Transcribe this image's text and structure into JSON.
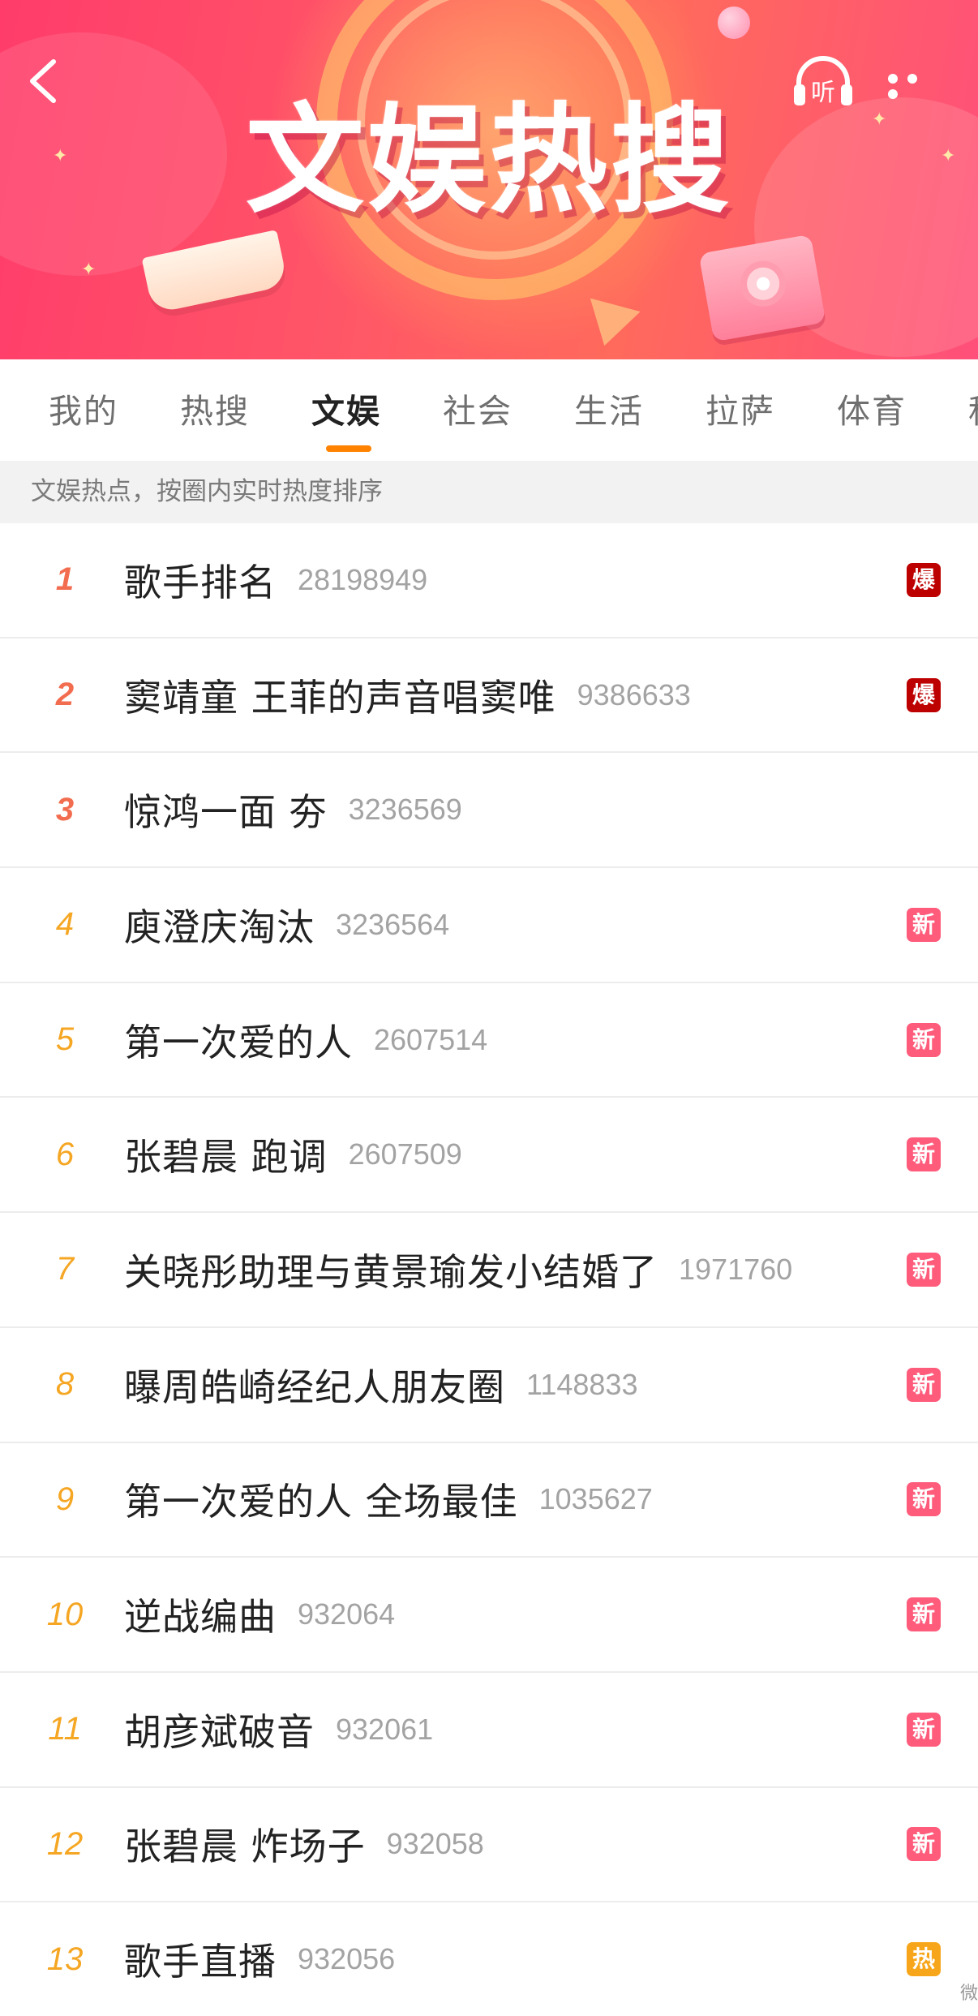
{
  "banner": {
    "title": "文娱热搜",
    "listen_label": "听"
  },
  "tabs": [
    {
      "label": "我的"
    },
    {
      "label": "热搜"
    },
    {
      "label": "文娱",
      "active": true
    },
    {
      "label": "社会"
    },
    {
      "label": "生活"
    },
    {
      "label": "拉萨"
    },
    {
      "label": "体育"
    },
    {
      "label": "科"
    }
  ],
  "subheader": "文娱热点，按圈内实时热度排序",
  "items": [
    {
      "rank": "1",
      "name": "歌手排名",
      "count": "28198949",
      "badge": "爆"
    },
    {
      "rank": "2",
      "name": "窦靖童 王菲的声音唱窦唯",
      "count": "9386633",
      "badge": "爆"
    },
    {
      "rank": "3",
      "name": "惊鸿一面 夯",
      "count": "3236569",
      "badge": ""
    },
    {
      "rank": "4",
      "name": "庾澄庆淘汰",
      "count": "3236564",
      "badge": "新"
    },
    {
      "rank": "5",
      "name": "第一次爱的人",
      "count": "2607514",
      "badge": "新"
    },
    {
      "rank": "6",
      "name": "张碧晨 跑调",
      "count": "2607509",
      "badge": "新"
    },
    {
      "rank": "7",
      "name": "关晓彤助理与黄景瑜发小结婚了",
      "count": "1971760",
      "badge": "新"
    },
    {
      "rank": "8",
      "name": "曝周皓崎经纪人朋友圈",
      "count": "1148833",
      "badge": "新"
    },
    {
      "rank": "9",
      "name": "第一次爱的人 全场最佳",
      "count": "1035627",
      "badge": "新"
    },
    {
      "rank": "10",
      "name": "逆战编曲",
      "count": "932064",
      "badge": "新"
    },
    {
      "rank": "11",
      "name": "胡彦斌破音",
      "count": "932061",
      "badge": "新"
    },
    {
      "rank": "12",
      "name": "张碧晨 炸场子",
      "count": "932058",
      "badge": "新"
    },
    {
      "rank": "13",
      "name": "歌手直播",
      "count": "932056",
      "badge": "热"
    }
  ],
  "corner_text": "微",
  "colors": {
    "accent": "#ff8200",
    "rank_top": "#f26d4f",
    "rank_other": "#f5a623",
    "badge_bao": "#bd0000",
    "badge_xin": "#ff5c7c",
    "badge_re": "#f7a61b"
  }
}
